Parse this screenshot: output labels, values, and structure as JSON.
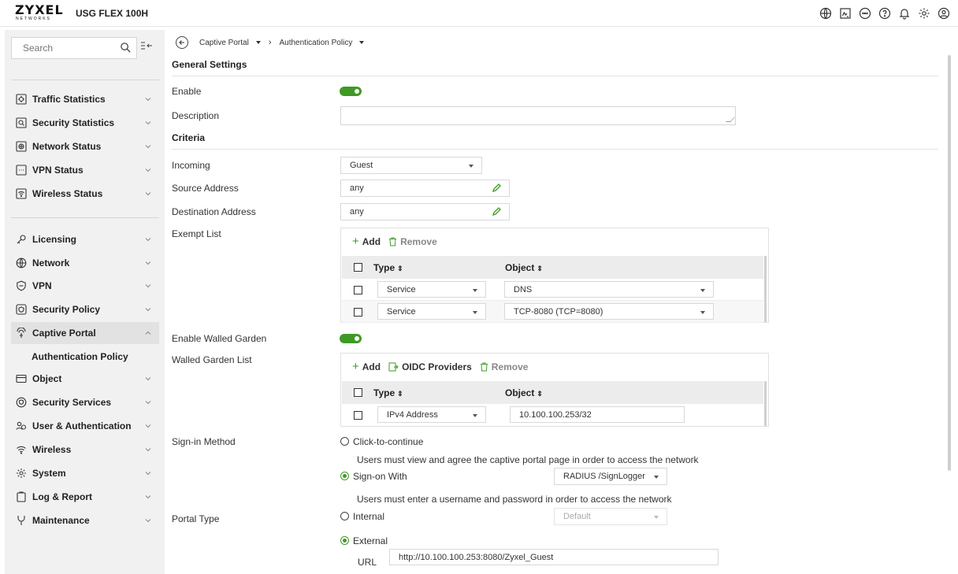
{
  "header": {
    "brand": "ZYXEL",
    "brand_sub": "NETWORKS",
    "model": "USG FLEX 100H",
    "icons": [
      "globe-icon",
      "chart-icon",
      "chat-icon",
      "help-icon",
      "bell-icon",
      "gear-icon",
      "user-icon"
    ]
  },
  "sidebar": {
    "search_placeholder": "Search",
    "group1": [
      {
        "label": "Traffic Statistics",
        "icon": "traffic-icon"
      },
      {
        "label": "Security Statistics",
        "icon": "shield-search-icon"
      },
      {
        "label": "Network Status",
        "icon": "network-status-icon"
      },
      {
        "label": "VPN Status",
        "icon": "vpn-status-icon"
      },
      {
        "label": "Wireless Status",
        "icon": "wireless-status-icon"
      }
    ],
    "group2": [
      {
        "label": "Licensing",
        "icon": "key-icon"
      },
      {
        "label": "Network",
        "icon": "globe-icon"
      },
      {
        "label": "VPN",
        "icon": "vpn-icon"
      },
      {
        "label": "Security Policy",
        "icon": "security-policy-icon"
      },
      {
        "label": "Captive Portal",
        "icon": "captive-portal-icon"
      },
      {
        "label": "Authentication Policy",
        "icon": ""
      },
      {
        "label": "Object",
        "icon": "object-icon"
      },
      {
        "label": "Security Services",
        "icon": "shield-icon"
      },
      {
        "label": "User & Authentication",
        "icon": "users-icon"
      },
      {
        "label": "Wireless",
        "icon": "wifi-icon"
      },
      {
        "label": "System",
        "icon": "gear-icon"
      },
      {
        "label": "Log & Report",
        "icon": "clipboard-icon"
      },
      {
        "label": "Maintenance",
        "icon": "wrench-icon"
      }
    ]
  },
  "breadcrumb": {
    "section": "Captive Portal",
    "page": "Authentication Policy"
  },
  "general": {
    "title": "General Settings",
    "enable_label": "Enable",
    "description_label": "Description",
    "description_value": ""
  },
  "criteria": {
    "title": "Criteria",
    "incoming_label": "Incoming",
    "incoming_value": "Guest",
    "source_label": "Source Address",
    "source_value": "any",
    "dest_label": "Destination Address",
    "dest_value": "any",
    "exempt_label": "Exempt List",
    "exempt": {
      "add": "Add",
      "remove": "Remove",
      "col_type": "Type",
      "col_object": "Object",
      "rows": [
        {
          "type": "Service",
          "object": "DNS"
        },
        {
          "type": "Service",
          "object": "TCP-8080 (TCP=8080)"
        }
      ]
    },
    "walled_garden_label": "Enable Walled Garden",
    "walled_list_label": "Walled Garden List",
    "walled": {
      "add": "Add",
      "oidc": "OIDC Providers",
      "remove": "Remove",
      "col_type": "Type",
      "col_object": "Object",
      "rows": [
        {
          "type": "IPv4 Address",
          "object": "10.100.100.253/32"
        }
      ]
    },
    "signin_label": "Sign-in Method",
    "signin": {
      "click_label": "Click-to-continue",
      "click_desc": "Users must view and agree the captive portal page in order to access the network",
      "signon_label": "Sign-on With",
      "signon_value": "RADIUS /SignLogger",
      "signon_desc": "Users must enter a username and password in order to access the network"
    },
    "portal_label": "Portal Type",
    "portal": {
      "internal_label": "Internal",
      "internal_value": "Default",
      "external_label": "External",
      "url_label": "URL",
      "url_value": "http://10.100.100.253:8080/Zyxel_Guest"
    }
  },
  "colors": {
    "accent_green": "#3e9a25",
    "sidebar_bg": "#f1f1f1"
  }
}
